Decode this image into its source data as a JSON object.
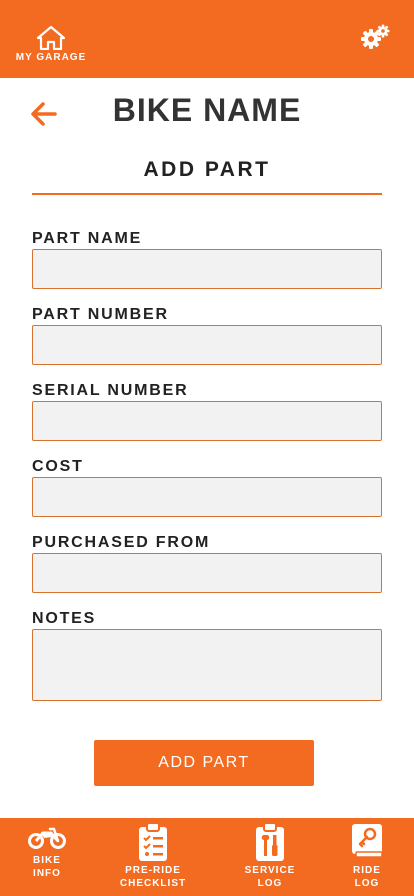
{
  "header": {
    "home_label": "MY GARAGE",
    "home_icon": "home-icon",
    "settings_icon": "gears-icon"
  },
  "page": {
    "bike_name": "BIKE NAME",
    "section_title": "ADD PART",
    "back_icon": "arrow-left-icon"
  },
  "form": {
    "part_name": {
      "label": "PART NAME",
      "value": "",
      "placeholder": ""
    },
    "part_number": {
      "label": "PART NUMBER",
      "value": "",
      "placeholder": ""
    },
    "serial_number": {
      "label": "SERIAL NUMBER",
      "value": "",
      "placeholder": ""
    },
    "cost": {
      "label": "COST",
      "value": "",
      "placeholder": ""
    },
    "purchased_from": {
      "label": "PURCHASED FROM",
      "value": "",
      "placeholder": ""
    },
    "notes": {
      "label": "NOTES",
      "value": "",
      "placeholder": ""
    },
    "submit_label": "ADD PART"
  },
  "bottom_nav": {
    "bike_info": {
      "line1": "BIKE",
      "line2": "INFO",
      "icon": "motorcycle-icon"
    },
    "checklist": {
      "line1": "PRE-RIDE",
      "line2": "CHECKLIST",
      "icon": "checklist-icon"
    },
    "service_log": {
      "line1": "SERVICE",
      "line2": "LOG",
      "icon": "tools-icon"
    },
    "ride_log": {
      "line1": "RIDE",
      "line2": "LOG",
      "icon": "book-icon"
    }
  },
  "colors": {
    "accent": "#f26b21",
    "input_bg": "#f2f2f2",
    "input_border": "#d8732f",
    "text_dark": "#333333"
  }
}
